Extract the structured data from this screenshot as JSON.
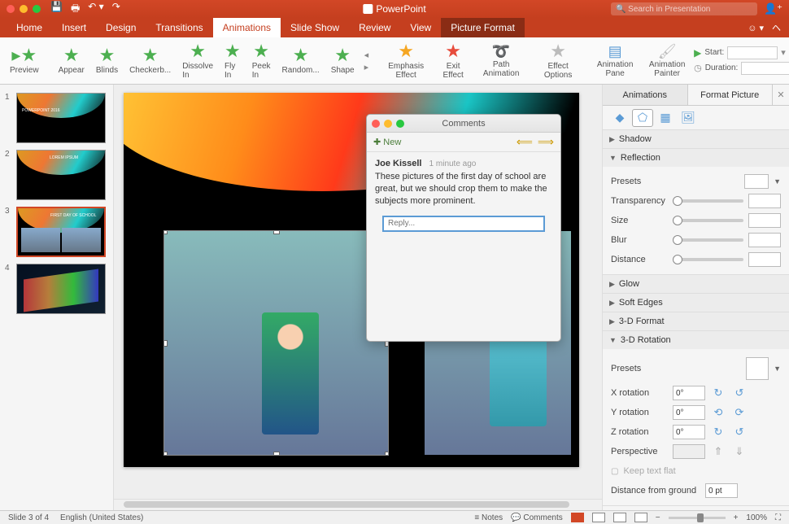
{
  "app": {
    "title": "PowerPoint",
    "search_placeholder": "Search in Presentation"
  },
  "tabs": [
    "Home",
    "Insert",
    "Design",
    "Transitions",
    "Animations",
    "Slide Show",
    "Review",
    "View"
  ],
  "context_tab": "Picture Format",
  "active_tab": "Animations",
  "ribbon": {
    "preview": "Preview",
    "effects": [
      "Appear",
      "Blinds",
      "Checkerb...",
      "Dissolve In",
      "Fly In",
      "Peek In",
      "Random...",
      "Shape"
    ],
    "emphasis": "Emphasis Effect",
    "exit": "Exit Effect",
    "path": "Path Animation",
    "options": "Effect Options",
    "pane": "Animation Pane",
    "painter": "Animation Painter",
    "start_label": "Start:",
    "duration_label": "Duration:"
  },
  "thumbs": {
    "count": 4,
    "selected": 3,
    "slide1_title": "POWERPOINT 2016",
    "slide2_title": "LOREM IPSUM",
    "slide3_title": "FIRST DAY OF SCHOOL"
  },
  "comments": {
    "title": "Comments",
    "new_label": "New",
    "author": "Joe Kissell",
    "time": "1 minute ago",
    "text": "These pictures of the first day of school are great, but we should crop them to make the subjects more prominent.",
    "reply_placeholder": "Reply..."
  },
  "rpane": {
    "tabs": [
      "Animations",
      "Format Picture"
    ],
    "active_tab": "Format Picture",
    "sections": {
      "shadow": "Shadow",
      "reflection": "Reflection",
      "glow": "Glow",
      "soft_edges": "Soft Edges",
      "threed_format": "3-D Format",
      "threed_rotation": "3-D Rotation"
    },
    "reflection": {
      "presets": "Presets",
      "transparency": "Transparency",
      "size": "Size",
      "blur": "Blur",
      "distance": "Distance"
    },
    "rotation": {
      "presets": "Presets",
      "x": "X rotation",
      "y": "Y rotation",
      "z": "Z rotation",
      "xval": "0°",
      "yval": "0°",
      "zval": "0°",
      "perspective": "Perspective",
      "keepflat": "Keep text flat",
      "distance_ground": "Distance from ground",
      "distance_val": "0 pt"
    }
  },
  "status": {
    "slide": "Slide 3 of 4",
    "lang": "English (United States)",
    "notes": "Notes",
    "comments": "Comments",
    "zoom": "100%"
  }
}
